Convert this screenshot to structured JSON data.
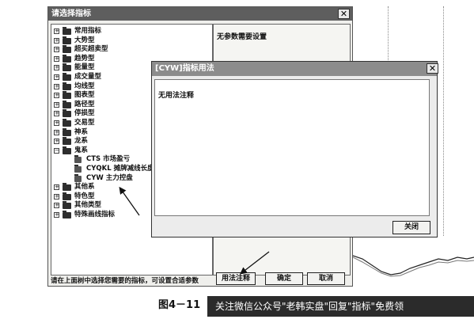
{
  "main_dialog": {
    "title": "请选择指标",
    "tree": [
      {
        "label": "常用指标",
        "type": "folder"
      },
      {
        "label": "大势型",
        "type": "folder"
      },
      {
        "label": "超买超卖型",
        "type": "folder"
      },
      {
        "label": "趋势型",
        "type": "folder"
      },
      {
        "label": "能量型",
        "type": "folder"
      },
      {
        "label": "成交量型",
        "type": "folder"
      },
      {
        "label": "均线型",
        "type": "folder"
      },
      {
        "label": "图表型",
        "type": "folder"
      },
      {
        "label": "路径型",
        "type": "folder"
      },
      {
        "label": "停损型",
        "type": "folder"
      },
      {
        "label": "交易型",
        "type": "folder"
      },
      {
        "label": "神系",
        "type": "folder"
      },
      {
        "label": "龙系",
        "type": "folder"
      },
      {
        "label": "鬼系",
        "type": "folder-open"
      },
      {
        "label": "CTS  市场盈亏",
        "type": "child"
      },
      {
        "label": "CYQKL  摊牌减线长度",
        "type": "child"
      },
      {
        "label": "CYW  主力控盘",
        "type": "child"
      },
      {
        "label": "其他系",
        "type": "folder"
      },
      {
        "label": "特色型",
        "type": "folder"
      },
      {
        "label": "其他类型",
        "type": "folder"
      },
      {
        "label": "特殊画线指标",
        "type": "folder"
      }
    ],
    "info_text": "无参数需要设置",
    "bottom_hint": "请在上面树中选择您需要的指标，可设置合适参数",
    "usage_button": "用法注释",
    "ok_button": "确定",
    "cancel_button": "取消"
  },
  "usage_dialog": {
    "title": "[CYW]指标用法",
    "body_text": "无用法注释",
    "close_button": "关闭"
  },
  "caption": {
    "figure_label": "图4－11",
    "banner_text": "关注微信公众号\"老韩实盘\"回复\"指标\"免费领"
  }
}
